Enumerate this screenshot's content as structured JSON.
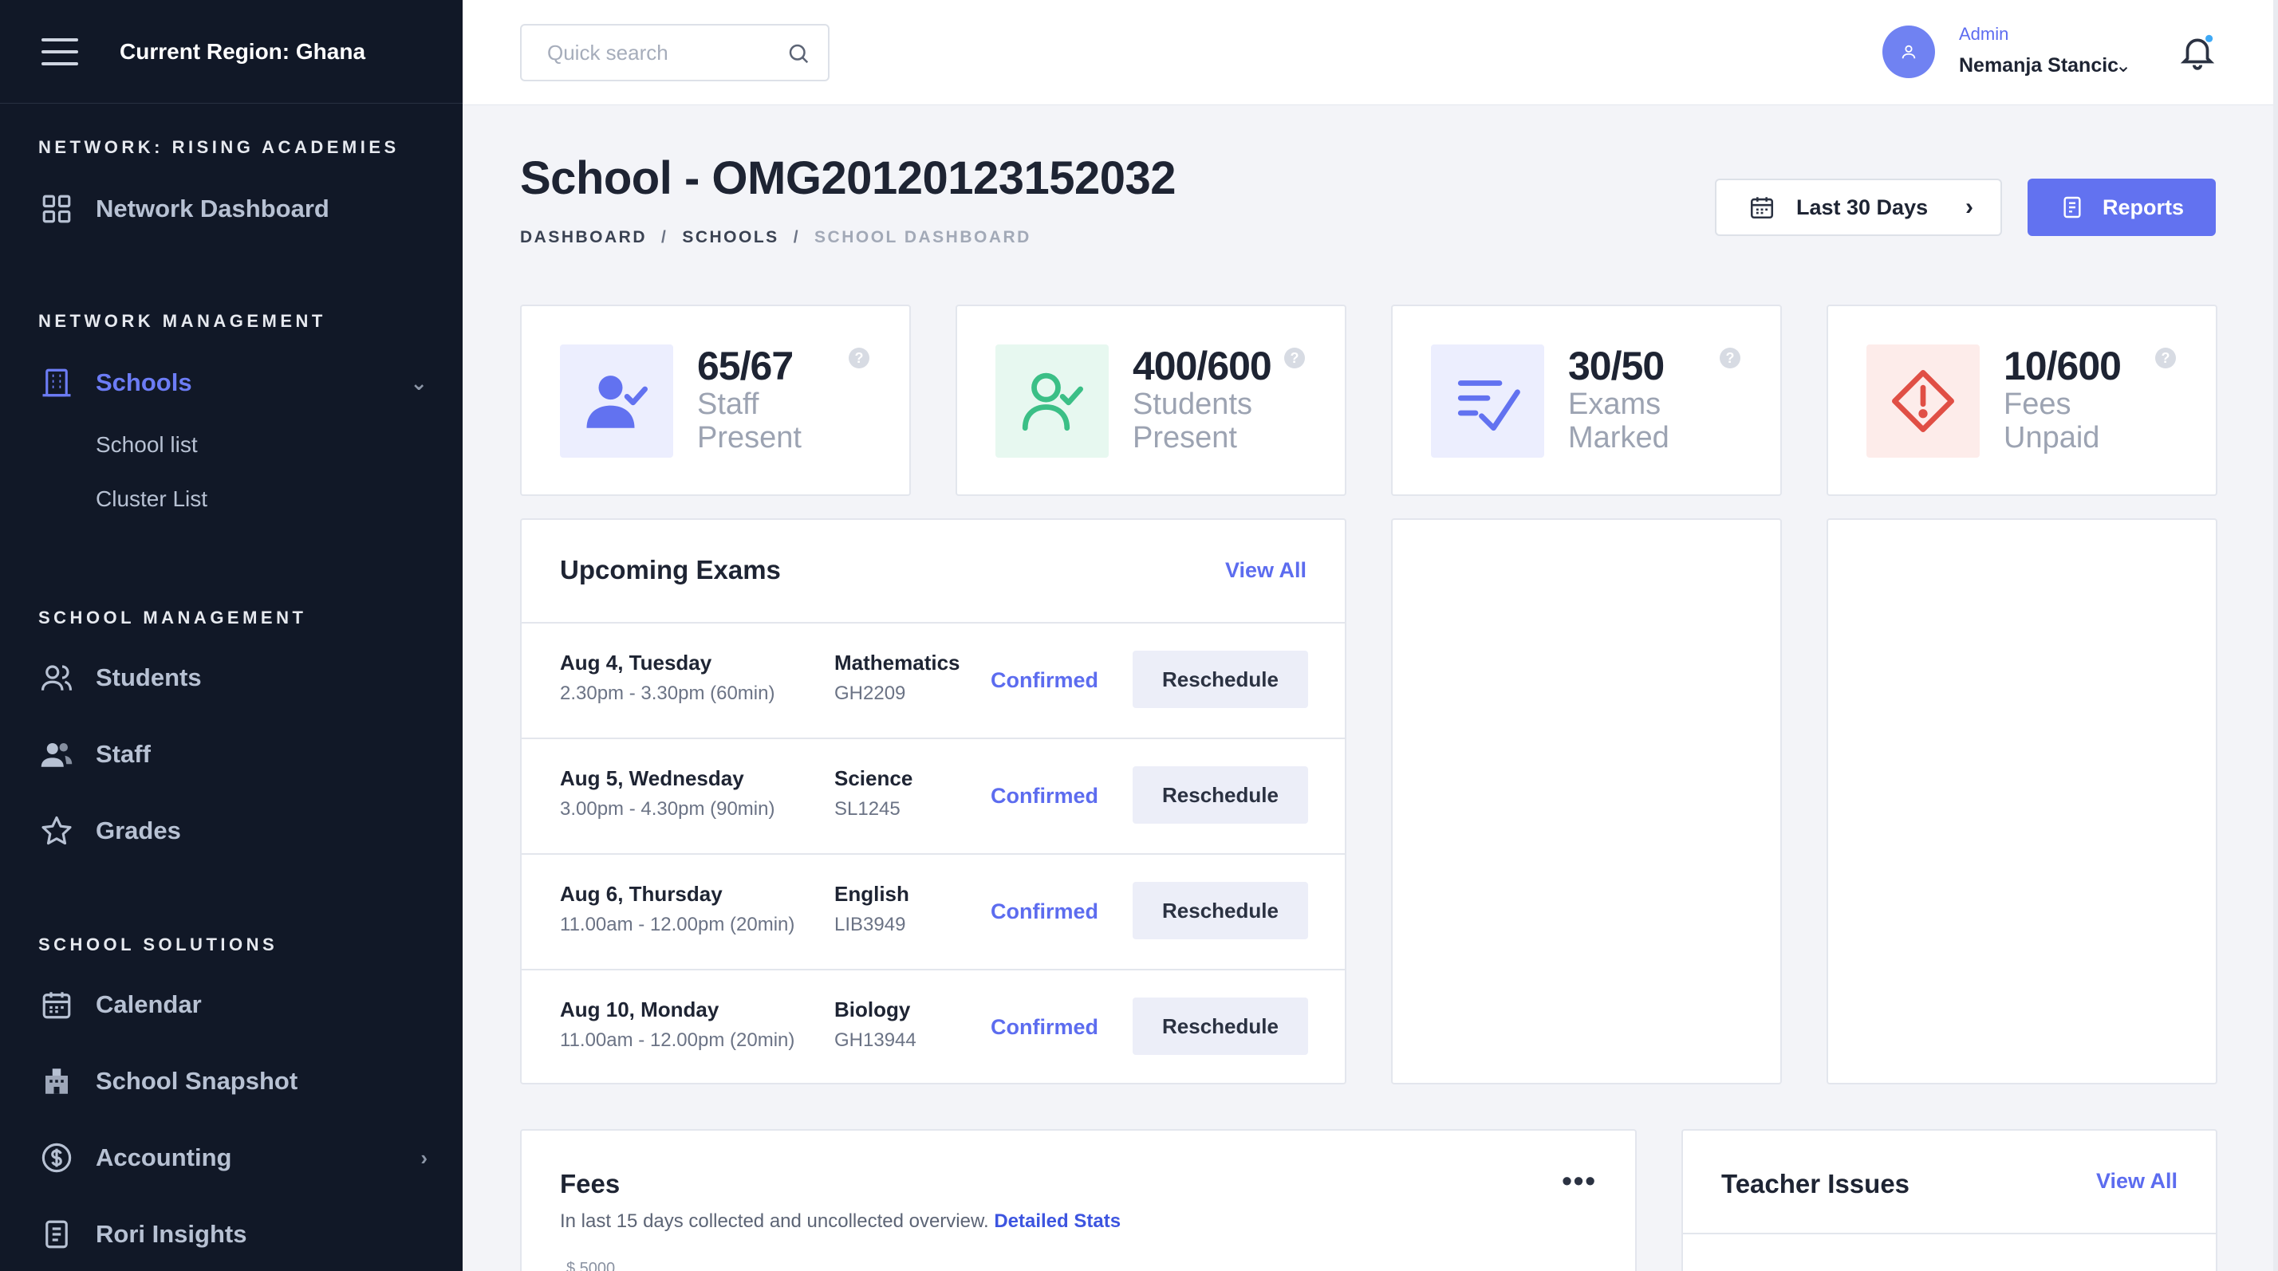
{
  "sidebar": {
    "region": "Current Region: Ghana",
    "sections": {
      "network": "NETWORK: RISING ACADEMIES",
      "network_management": "NETWORK MANAGEMENT",
      "school_management": "SCHOOL MANAGEMENT",
      "school_solutions": "SCHOOL SOLUTIONS"
    },
    "items": {
      "network_dashboard": "Network Dashboard",
      "schools": "Schools",
      "school_list": "School list",
      "cluster_list": "Cluster List",
      "students": "Students",
      "staff": "Staff",
      "grades": "Grades",
      "calendar": "Calendar",
      "school_snapshot": "School Snapshot",
      "accounting": "Accounting",
      "rori_insights": "Rori Insights"
    }
  },
  "topbar": {
    "search_placeholder": "Quick search",
    "user_role": "Admin",
    "user_name": "Nemanja Stancic"
  },
  "header": {
    "title": "School - OMG20120123152032",
    "breadcrumb": [
      "DASHBOARD",
      "SCHOOLS",
      "SCHOOL DASHBOARD"
    ],
    "range_label": "Last 30 Days",
    "reports_label": "Reports"
  },
  "stats": [
    {
      "value": "65/67",
      "label": "Staff Present",
      "color": "#6272f0",
      "bg": "#eceefe",
      "icon": "user-check-icon"
    },
    {
      "value": "400/600",
      "label": "Students Present",
      "color": "#3bbf86",
      "bg": "#e7f8f0",
      "icon": "user-check-outline-icon"
    },
    {
      "value": "30/50",
      "label": "Exams Marked",
      "color": "#6272f0",
      "bg": "#eceefe",
      "icon": "checklist-icon"
    },
    {
      "value": "10/600",
      "label": "Fees Unpaid",
      "color": "#e04f45",
      "bg": "#fdecea",
      "icon": "alert-octagon-icon"
    }
  ],
  "exams": {
    "title": "Upcoming Exams",
    "view_all": "View All",
    "rows": [
      {
        "date": "Aug 4, Tuesday",
        "time": "2.30pm - 3.30pm (60min)",
        "subject": "Mathematics",
        "code": "GH2209",
        "status": "Confirmed",
        "action": "Reschedule"
      },
      {
        "date": "Aug 5, Wednesday",
        "time": "3.00pm - 4.30pm (90min)",
        "subject": "Science",
        "code": "SL1245",
        "status": "Confirmed",
        "action": "Reschedule"
      },
      {
        "date": "Aug 6, Thursday",
        "time": "11.00am - 12.00pm (20min)",
        "subject": "English",
        "code": "LIB3949",
        "status": "Confirmed",
        "action": "Reschedule"
      },
      {
        "date": "Aug 10, Monday",
        "time": "11.00am - 12.00pm (20min)",
        "subject": "Biology",
        "code": "GH13944",
        "status": "Confirmed",
        "action": "Reschedule"
      }
    ]
  },
  "fees": {
    "title": "Fees",
    "subtitle": "In last 15 days collected and uncollected overview.",
    "link": "Detailed Stats",
    "axis_top": "$ 5000"
  },
  "teacher_issues": {
    "title": "Teacher Issues",
    "view_all": "View All"
  },
  "colors": {
    "accent": "#6272f0",
    "sidebar_bg": "#111827"
  }
}
